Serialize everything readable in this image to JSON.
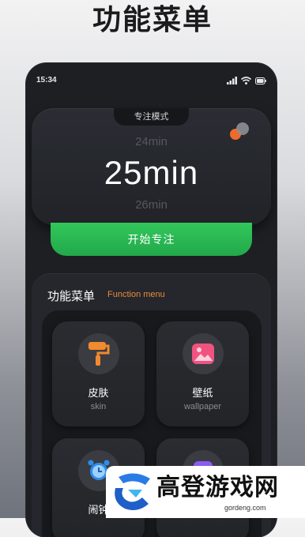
{
  "headline": "功能菜单",
  "statusbar": {
    "time": "15:34"
  },
  "focus": {
    "mode_label": "专注模式",
    "prev_time": "24min",
    "current_time": "25min",
    "next_time": "26min",
    "start_label": "开始专注"
  },
  "menu": {
    "title": "功能菜单",
    "subtitle": "Function menu",
    "items": [
      {
        "label": "皮肤",
        "sub": "skin",
        "icon": "paint-roller-icon"
      },
      {
        "label": "壁纸",
        "sub": "wallpaper",
        "icon": "image-icon"
      },
      {
        "label": "闹钟",
        "sub": "",
        "icon": "alarm-clock-icon"
      },
      {
        "label": "",
        "sub": "",
        "icon": "app-icon"
      }
    ]
  },
  "watermark": {
    "text": "高登游戏网",
    "url": "gordeng.com"
  },
  "colors": {
    "accent_green": "#2bbd55",
    "accent_orange": "#e88b3d",
    "background": "#1d1f23"
  }
}
